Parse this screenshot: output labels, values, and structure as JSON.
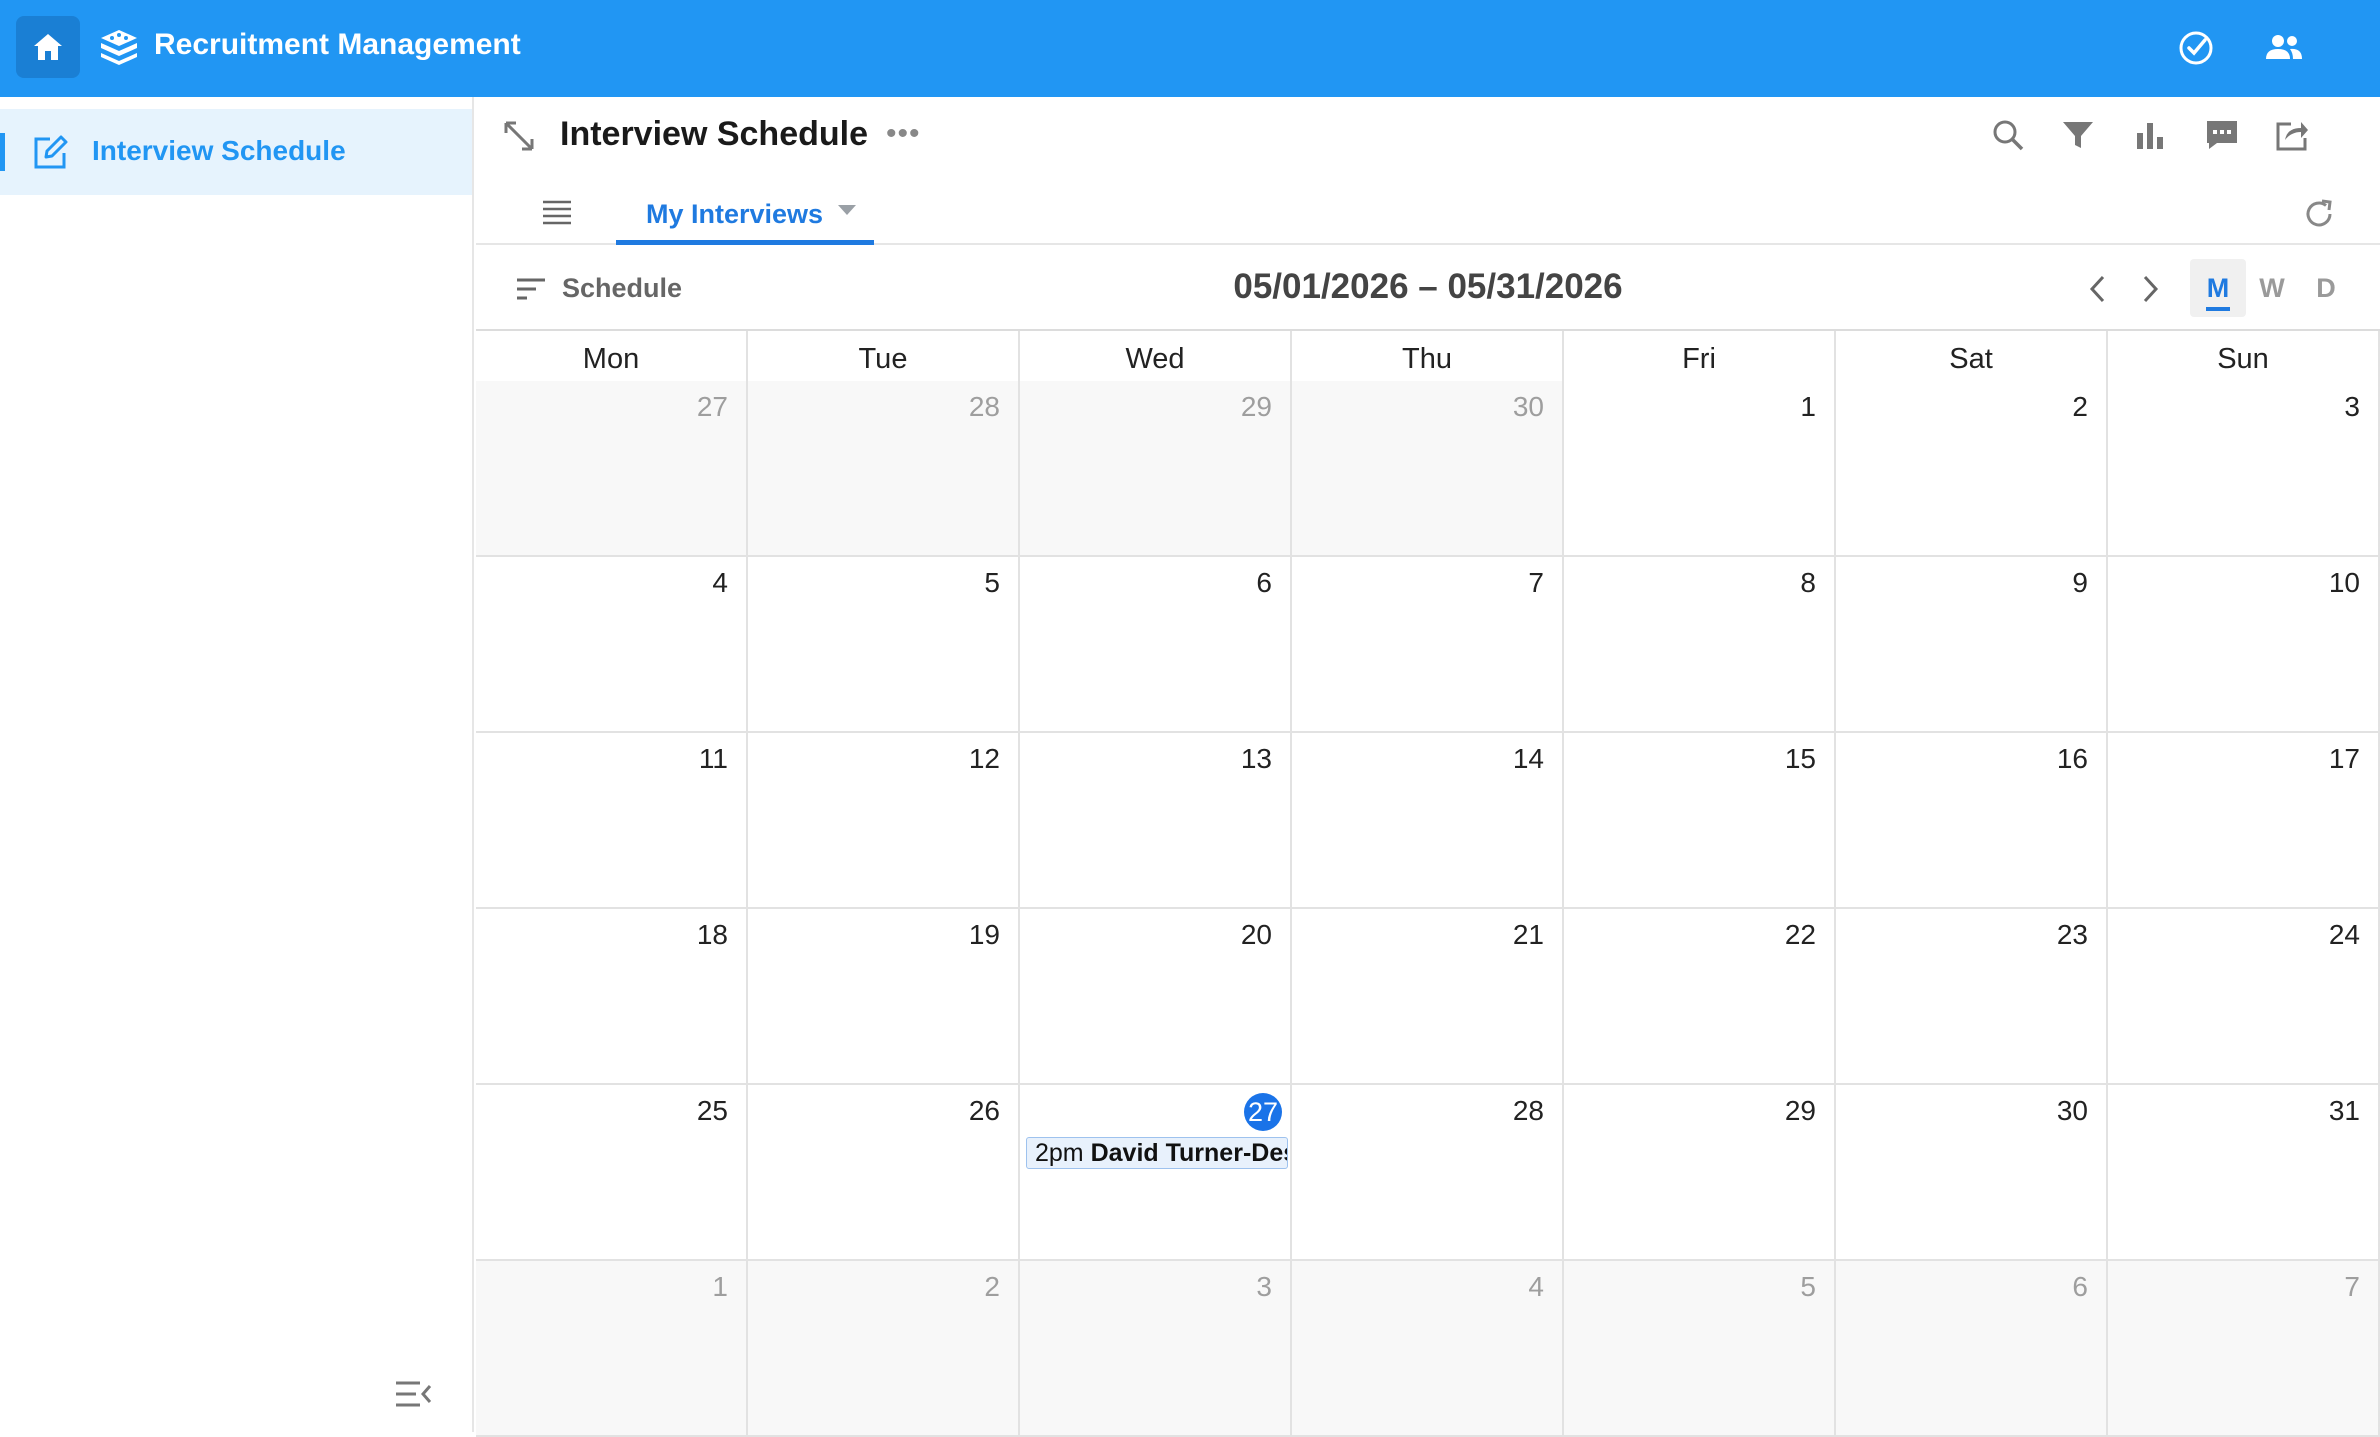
{
  "app": {
    "title": "Recruitment Management"
  },
  "sidebar": {
    "items": [
      {
        "label": "Interview Schedule",
        "icon": "edit-icon",
        "active": true
      }
    ]
  },
  "header": {
    "title": "Interview Schedule"
  },
  "tabs": {
    "active_label": "My Interviews"
  },
  "toolbar": {
    "schedule_label": "Schedule",
    "date_range": "05/01/2026 – 05/31/2026",
    "views": [
      "M",
      "W",
      "D"
    ],
    "active_view": "M"
  },
  "calendar": {
    "days_of_week": [
      "Mon",
      "Tue",
      "Wed",
      "Thu",
      "Fri",
      "Sat",
      "Sun"
    ],
    "weeks": [
      [
        {
          "d": "27",
          "o": true
        },
        {
          "d": "28",
          "o": true
        },
        {
          "d": "29",
          "o": true
        },
        {
          "d": "30",
          "o": true
        },
        {
          "d": "1"
        },
        {
          "d": "2"
        },
        {
          "d": "3"
        }
      ],
      [
        {
          "d": "4"
        },
        {
          "d": "5"
        },
        {
          "d": "6"
        },
        {
          "d": "7"
        },
        {
          "d": "8"
        },
        {
          "d": "9"
        },
        {
          "d": "10"
        }
      ],
      [
        {
          "d": "11"
        },
        {
          "d": "12"
        },
        {
          "d": "13"
        },
        {
          "d": "14"
        },
        {
          "d": "15"
        },
        {
          "d": "16"
        },
        {
          "d": "17"
        }
      ],
      [
        {
          "d": "18"
        },
        {
          "d": "19"
        },
        {
          "d": "20"
        },
        {
          "d": "21"
        },
        {
          "d": "22"
        },
        {
          "d": "23"
        },
        {
          "d": "24"
        }
      ],
      [
        {
          "d": "25"
        },
        {
          "d": "26"
        },
        {
          "d": "27",
          "today": true,
          "event": {
            "time": "2pm",
            "title": "David Turner-Des"
          }
        },
        {
          "d": "28"
        },
        {
          "d": "29"
        },
        {
          "d": "30"
        },
        {
          "d": "31"
        }
      ],
      [
        {
          "d": "1",
          "o": true
        },
        {
          "d": "2",
          "o": true
        },
        {
          "d": "3",
          "o": true
        },
        {
          "d": "4",
          "o": true
        },
        {
          "d": "5",
          "o": true
        },
        {
          "d": "6",
          "o": true
        },
        {
          "d": "7",
          "o": true
        }
      ]
    ]
  },
  "colors": {
    "brand": "#2196f3",
    "accent": "#1f7ae0",
    "today": "#1a73e8"
  }
}
